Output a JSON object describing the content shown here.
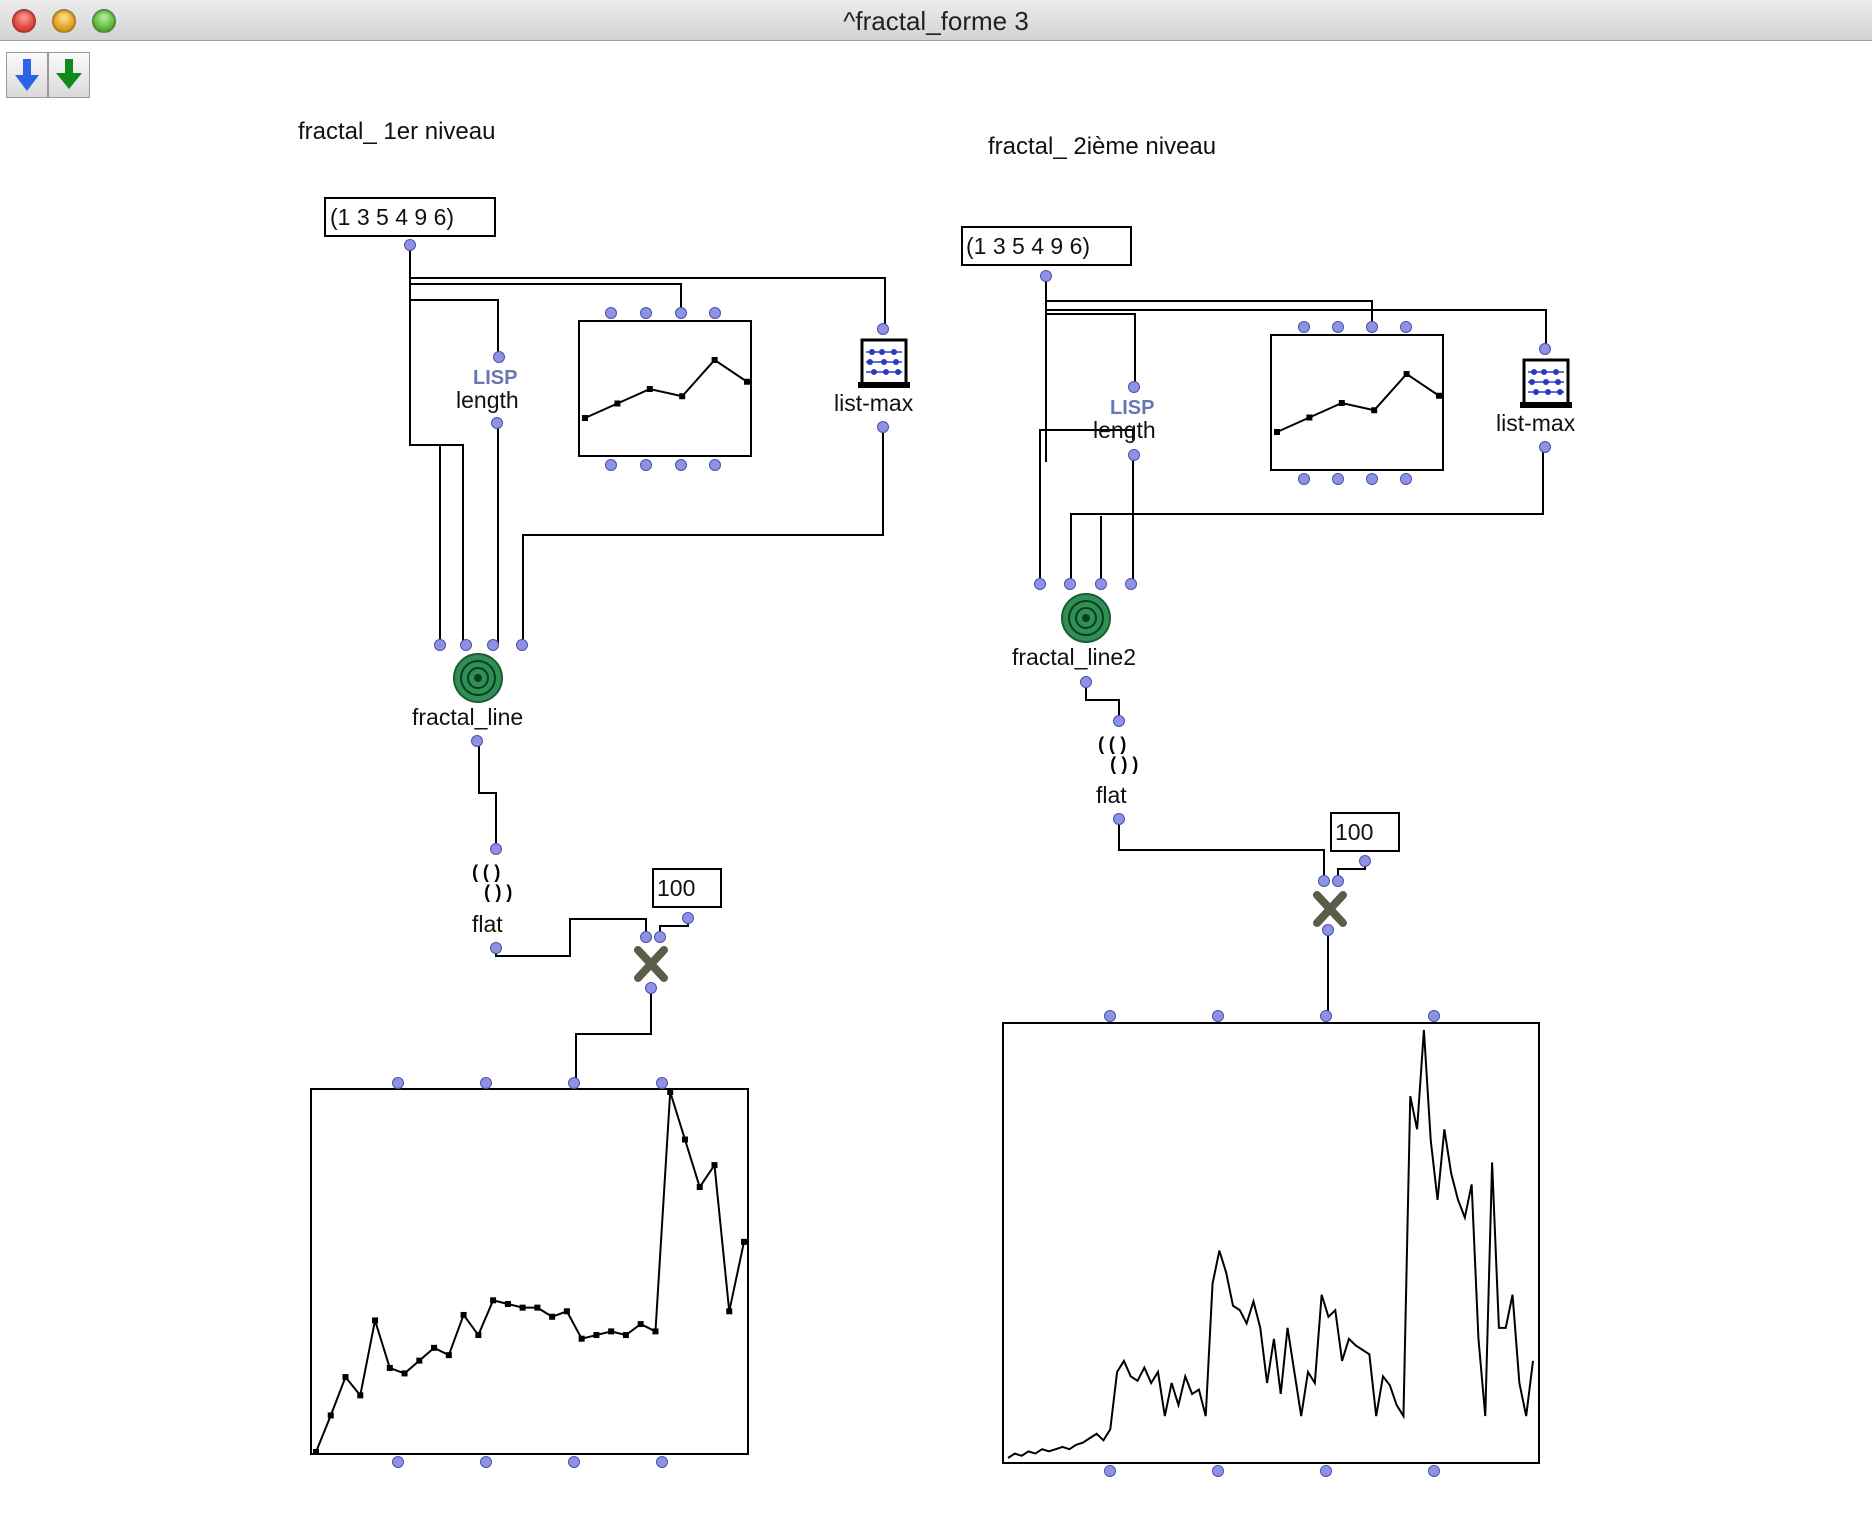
{
  "window": {
    "title": "^fractal_forme 3"
  },
  "toolbar": {
    "buttons": [
      "down-arrow-blue",
      "down-arrow-green"
    ]
  },
  "patch": {
    "left": {
      "comment": "fractal_ 1er niveau",
      "input_list": "(1 3 5 4 9 6)",
      "length_label": "length",
      "lisp_label": "LISP",
      "listmax_label": "list-max",
      "fractal_label": "fractal_line",
      "flat_label": "flat",
      "number": "100"
    },
    "right": {
      "comment": "fractal_ 2ième niveau",
      "input_list": "(1 3 5 4 9 6)",
      "length_label": "length",
      "lisp_label": "LISP",
      "listmax_label": "list-max",
      "fractal_label": "fractal_line2",
      "flat_label": "flat",
      "number": "100"
    }
  },
  "chart_data": [
    {
      "type": "line",
      "name": "input-bpf-left",
      "y": [
        1,
        3,
        5,
        4,
        9,
        6
      ]
    },
    {
      "type": "line",
      "name": "input-bpf-right",
      "y": [
        1,
        3,
        5,
        4,
        9,
        6
      ]
    },
    {
      "type": "line",
      "name": "result-bpf-left",
      "y": [
        0,
        20,
        41,
        31,
        72,
        46,
        43,
        50,
        57,
        53,
        75,
        64,
        83,
        81,
        79,
        79,
        74,
        77,
        62,
        64,
        66,
        64,
        70,
        66,
        197,
        171,
        145,
        157,
        77,
        115
      ]
    },
    {
      "type": "line",
      "name": "result-bpf-right",
      "y": [
        1,
        3,
        2,
        4,
        3,
        5,
        4,
        5,
        6,
        5,
        7,
        8,
        10,
        12,
        9,
        14,
        40,
        45,
        38,
        36,
        42,
        35,
        40,
        20,
        35,
        25,
        38,
        30,
        32,
        20,
        80,
        95,
        85,
        70,
        68,
        62,
        72,
        60,
        35,
        55,
        30,
        60,
        40,
        20,
        40,
        35,
        75,
        65,
        68,
        45,
        55,
        52,
        50,
        48,
        20,
        38,
        34,
        25,
        20,
        165,
        150,
        195,
        145,
        118,
        150,
        130,
        118,
        110,
        125,
        55,
        20,
        135,
        60,
        60,
        75,
        35,
        20,
        45
      ]
    }
  ]
}
